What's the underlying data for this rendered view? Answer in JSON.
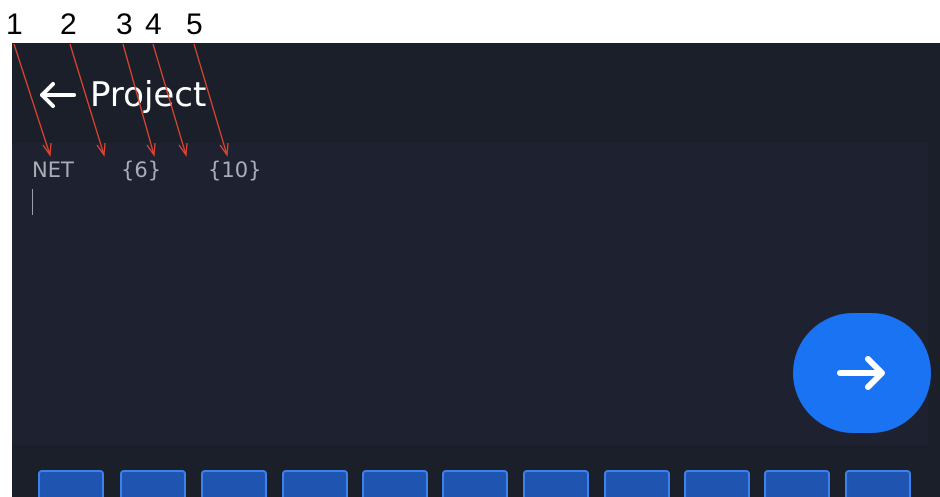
{
  "annotations": [
    "1",
    "2",
    "3",
    "4",
    "5"
  ],
  "header": {
    "back_icon": "arrow-left-icon",
    "title": "Project"
  },
  "editor": {
    "tokens": [
      "NET",
      "{6}",
      "{10}"
    ]
  },
  "next_button": {
    "icon": "arrow-right-icon"
  },
  "colors": {
    "screen_bg": "#1b1f2a",
    "editor_bg": "#1e2130",
    "accent": "#1a73f2",
    "annotation_arrow": "#e0442e",
    "key_fill": "#1f55b0",
    "key_border": "#3b82f0"
  }
}
